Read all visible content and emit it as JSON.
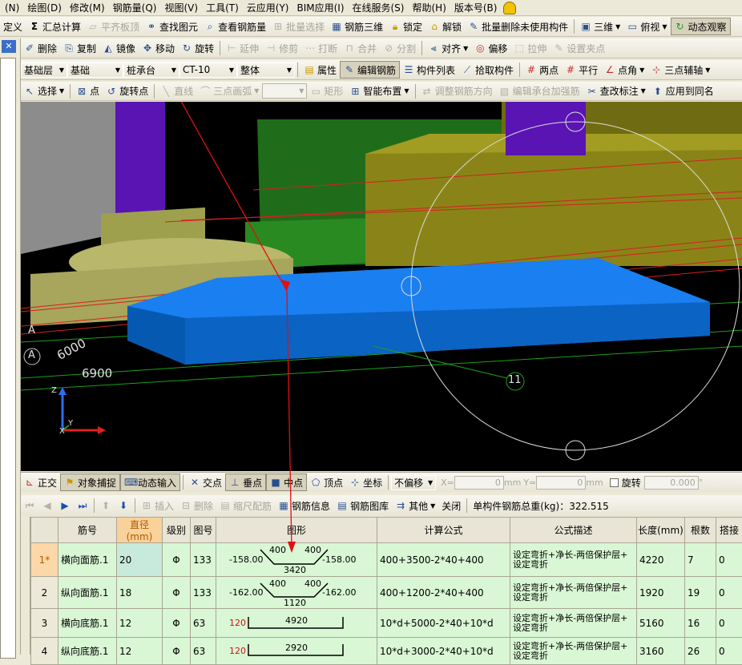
{
  "menu": [
    "(N)",
    "绘图(D)",
    "修改(M)",
    "钢筋量(Q)",
    "视图(V)",
    "工具(T)",
    "云应用(Y)",
    "BIM应用(I)",
    "在线服务(S)",
    "帮助(H)",
    "版本号(B)"
  ],
  "toolbar1": {
    "items": [
      "定义",
      "汇总计算",
      "平齐板顶",
      "查找图元",
      "查看钢筋量",
      "批量选择",
      "钢筋三维",
      "锁定",
      "解锁",
      "批量删除未使用构件",
      "三维",
      "俯视",
      "动态观察"
    ]
  },
  "toolbar2": {
    "items": [
      "删除",
      "复制",
      "镜像",
      "移动",
      "旋转",
      "延伸",
      "修剪",
      "打断",
      "合并",
      "分割",
      "对齐",
      "偏移",
      "拉伸",
      "设置夹点"
    ]
  },
  "toolbar3": {
    "floor": "基础层",
    "category": "基础",
    "type": "桩承台",
    "component": "CT-10",
    "scope": "整体",
    "items": [
      "属性",
      "编辑钢筋",
      "构件列表",
      "拾取构件",
      "两点",
      "平行",
      "点角",
      "三点辅轴"
    ]
  },
  "toolbar4": {
    "items": [
      "选择",
      "点",
      "旋转点",
      "直线",
      "三点画弧",
      "矩形",
      "智能布置",
      "调整钢筋方向",
      "编辑承台加强筋",
      "查改标注",
      "应用到同名"
    ]
  },
  "viewport": {
    "labels": {
      "axis_a1": "A",
      "axis_a2": "A",
      "dim1": "6000",
      "dim2": "6900",
      "circle_num": "11"
    },
    "axes": {
      "z": "Z",
      "y": "Y",
      "x": "X"
    }
  },
  "snapbar": {
    "items": [
      "正交",
      "对象捕捉",
      "动态输入",
      "交点",
      "垂点",
      "中点",
      "顶点",
      "坐标"
    ],
    "offset_mode": "不偏移",
    "x_label": "X=",
    "x_value": "0",
    "y_label": "Y=",
    "y_value": "0",
    "unit": "mm",
    "rotate_label": "旋转",
    "rotate_value": "0.000",
    "deg": "°"
  },
  "tablebar": {
    "items": [
      "插入",
      "删除",
      "缩尺配筋",
      "钢筋信息",
      "钢筋图库",
      "其他",
      "关闭"
    ],
    "total_label": "单构件钢筋总重(kg)：322.515"
  },
  "grid": {
    "headers": [
      "筋号",
      "直径(mm)",
      "级别",
      "图号",
      "图形",
      "计算公式",
      "公式描述",
      "长度(mm)",
      "根数",
      "搭接"
    ],
    "rows": [
      {
        "rn": "1*",
        "name": "横向面筋.1",
        "dia": "20",
        "grade": "Φ",
        "fig": "133",
        "shape": {
          "left": "-158.00",
          "right": "-158.00",
          "top1": "400",
          "top2": "400",
          "bottom": "3420"
        },
        "formula": "400+3500-2*40+400",
        "desc1": "设定弯折+净长-两倍保护层+",
        "desc2": "设定弯折",
        "length": "4220",
        "count": "7",
        "lap": "0"
      },
      {
        "rn": "2",
        "name": "纵向面筋.1",
        "dia": "18",
        "grade": "Φ",
        "fig": "133",
        "shape": {
          "left": "-162.00",
          "right": "-162.00",
          "top1": "400",
          "top2": "400",
          "bottom": "1120"
        },
        "formula": "400+1200-2*40+400",
        "desc1": "设定弯折+净长-两倍保护层+",
        "desc2": "设定弯折",
        "length": "1920",
        "count": "19",
        "lap": "0"
      },
      {
        "rn": "3",
        "name": "横向底筋.1",
        "dia": "12",
        "grade": "Φ",
        "fig": "63",
        "shape": {
          "hook": "120",
          "mid": "4920"
        },
        "formula": "10*d+5000-2*40+10*d",
        "desc1": "设定弯折+净长-两倍保护层+",
        "desc2": "设定弯折",
        "length": "5160",
        "count": "16",
        "lap": "0"
      },
      {
        "rn": "4",
        "name": "纵向底筋.1",
        "dia": "12",
        "grade": "Φ",
        "fig": "63",
        "shape": {
          "hook": "120",
          "mid": "2920"
        },
        "formula": "10*d+3000-2*40+10*d",
        "desc1": "设定弯折+净长-两倍保护层+",
        "desc2": "设定弯折",
        "length": "3160",
        "count": "26",
        "lap": "0"
      }
    ]
  },
  "colors": {
    "slab": "#0a6fd8",
    "green_row": "#d9f7d4",
    "menu_bg": "#ece9d8"
  }
}
